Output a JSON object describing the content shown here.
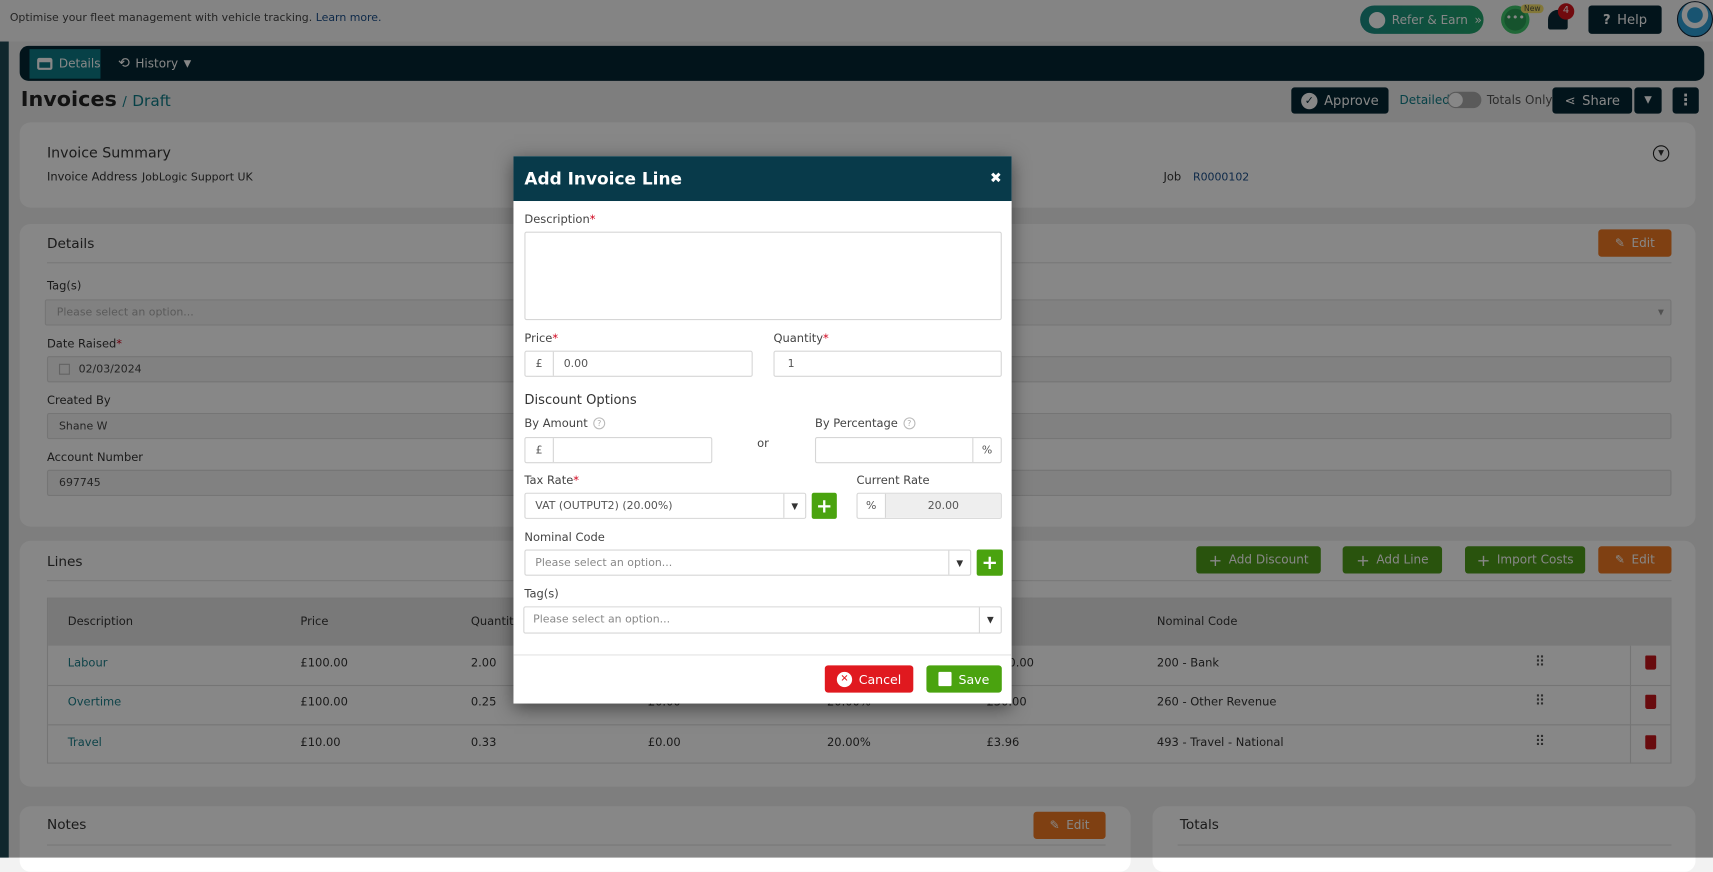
{
  "banner": {
    "text": "Optimise your fleet management with vehicle tracking.",
    "link": "Learn more."
  },
  "topbar": {
    "refer": "Refer & Earn",
    "new_badge": "New",
    "notifications": "4",
    "help": "Help"
  },
  "nav": {
    "details": "Details",
    "history": "History"
  },
  "title": {
    "main": "Invoices",
    "sep": "/",
    "status": "Draft"
  },
  "actions": {
    "approve": "Approve",
    "detailed": "Detailed",
    "totals_only": "Totals Only",
    "share": "Share",
    "toggle_on": false
  },
  "summary": {
    "title": "Invoice Summary",
    "address_label": "Invoice Address",
    "address": "JobLogic Support UK",
    "job_label": "Job",
    "job": "R0000102"
  },
  "details": {
    "title": "Details",
    "edit": "Edit",
    "tags_label": "Tag(s)",
    "tags_placeholder": "Please select an option...",
    "date_label": "Date Raised",
    "date": "02/03/2024",
    "created_label": "Created By",
    "created": "Shane W",
    "account_label": "Account Number",
    "account": "697745"
  },
  "lines": {
    "title": "Lines",
    "add_discount": "Add Discount",
    "add_line": "Add Line",
    "import_costs": "Import Costs",
    "edit": "Edit",
    "headers": [
      "Description",
      "Price",
      "Quantity",
      "",
      "",
      "",
      "Nominal Code"
    ],
    "rows": [
      [
        "Labour",
        "£100.00",
        "2.00",
        "",
        "",
        "£240.00",
        "200 - Bank"
      ],
      [
        "Overtime",
        "£100.00",
        "0.25",
        "£0.00",
        "20.00%",
        "£30.00",
        "260 - Other Revenue"
      ],
      [
        "Travel",
        "£10.00",
        "0.33",
        "£0.00",
        "20.00%",
        "£3.96",
        "493 - Travel - National"
      ]
    ]
  },
  "notes": {
    "title": "Notes",
    "edit": "Edit"
  },
  "totals": {
    "title": "Totals"
  },
  "modal": {
    "title": "Add Invoice Line",
    "description_label": "Description",
    "description": "",
    "price_label": "Price",
    "currency": "£",
    "price": "0.00",
    "quantity_label": "Quantity",
    "quantity": "1",
    "discount_title": "Discount Options",
    "by_amount": "By Amount",
    "or": "or",
    "by_percentage": "By Percentage",
    "percent": "%",
    "tax_label": "Tax Rate",
    "tax_value": "VAT (OUTPUT2) (20.00%)",
    "current_rate_label": "Current Rate",
    "current_rate": "20.00",
    "nominal_label": "Nominal Code",
    "nominal_placeholder": "Please select an option...",
    "tags_label": "Tag(s)",
    "tags_placeholder": "Please select an option...",
    "cancel": "Cancel",
    "save": "Save"
  },
  "colors": {
    "nav": "#052633",
    "accent": "#0e7c86",
    "green": "#4aa30f",
    "orange": "#f07a22",
    "red": "#e0191f",
    "modal_header": "#083a4a"
  }
}
